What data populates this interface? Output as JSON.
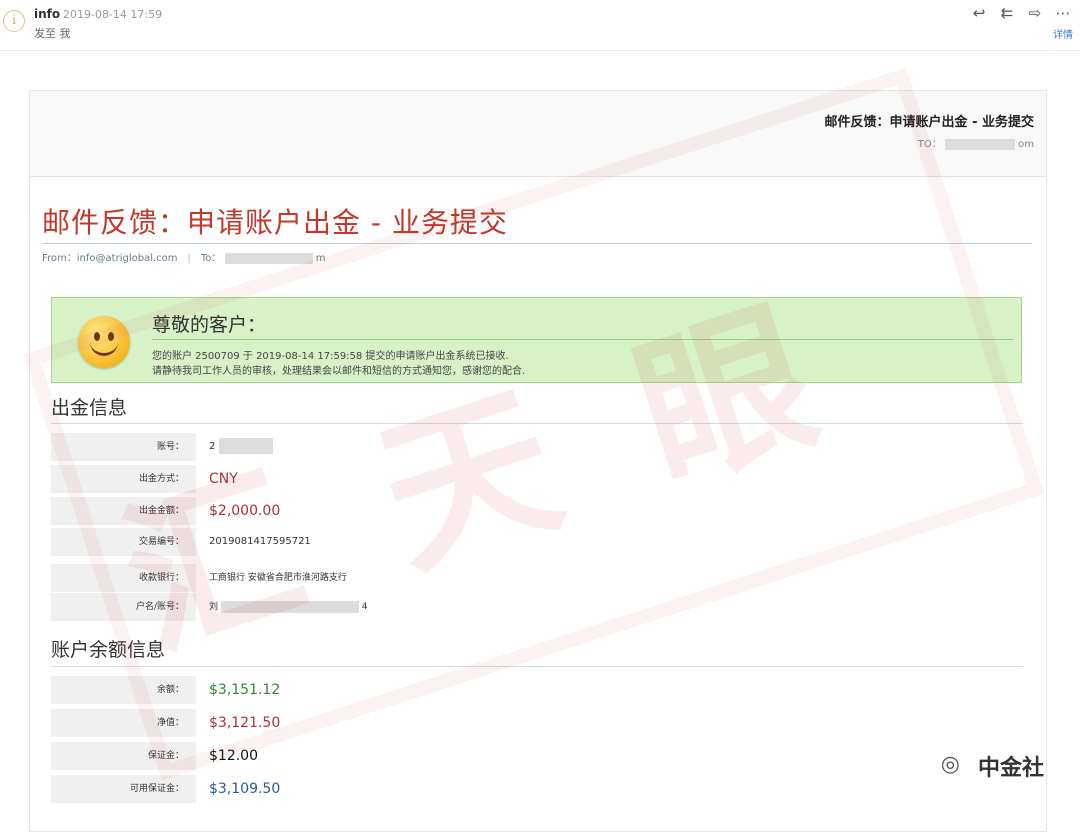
{
  "mail_header": {
    "sender_initial": "i",
    "sender": "info",
    "datetime": "2019-08-14 17:59",
    "sent_to": "发至 我",
    "actions": [
      "reply-icon",
      "reply-all-icon",
      "forward-icon",
      "more-icon"
    ],
    "details_label": "详情"
  },
  "email": {
    "band_title": "邮件反馈：申请账户出金 - 业务提交",
    "band_to_prefix": "TO：",
    "band_to_suffix": "om",
    "main_title": "邮件反馈：申请账户出金 - 业务提交",
    "from_label": "From：info@atriglobal.com",
    "to_label": "To：",
    "to_suffix": "m",
    "greeting": {
      "title": "尊敬的客户：",
      "line1": "您的账户 2500709 于 2019-08-14 17:59:58 提交的申请账户出金系统已接收.",
      "line2": "请静待我司工作人员的审核，处理结果会以邮件和短信的方式通知您，感谢您的配合."
    },
    "withdrawal": {
      "section_title": "出金信息",
      "rows": [
        {
          "label": "账号：",
          "value": "2"
        },
        {
          "label": "出金方式：",
          "value": "CNY"
        },
        {
          "label": "出金金额：",
          "value": "$2,000.00"
        },
        {
          "label": "交易编号：",
          "value": "2019081417595721"
        },
        {
          "label": "收款银行：",
          "value": "工商银行 安徽省合肥市淮河路支行"
        },
        {
          "label": "户名/账号：",
          "value": "刘",
          "suffix": "4"
        }
      ]
    },
    "balance": {
      "section_title": "账户余额信息",
      "rows": [
        {
          "label": "余额：",
          "value": "$3,151.12"
        },
        {
          "label": "净值：",
          "value": "$3,121.50"
        },
        {
          "label": "保证金：",
          "value": "$12.00"
        },
        {
          "label": "可用保证金：",
          "value": "$3,109.50"
        }
      ]
    }
  },
  "watermark_text": "汇 天 眼",
  "brand": "中金社",
  "colors": {
    "accent_red": "#c0392b",
    "greet_bg": "#d7f2c7",
    "green": "#2e8b2e",
    "blue": "#2a5a9a"
  }
}
